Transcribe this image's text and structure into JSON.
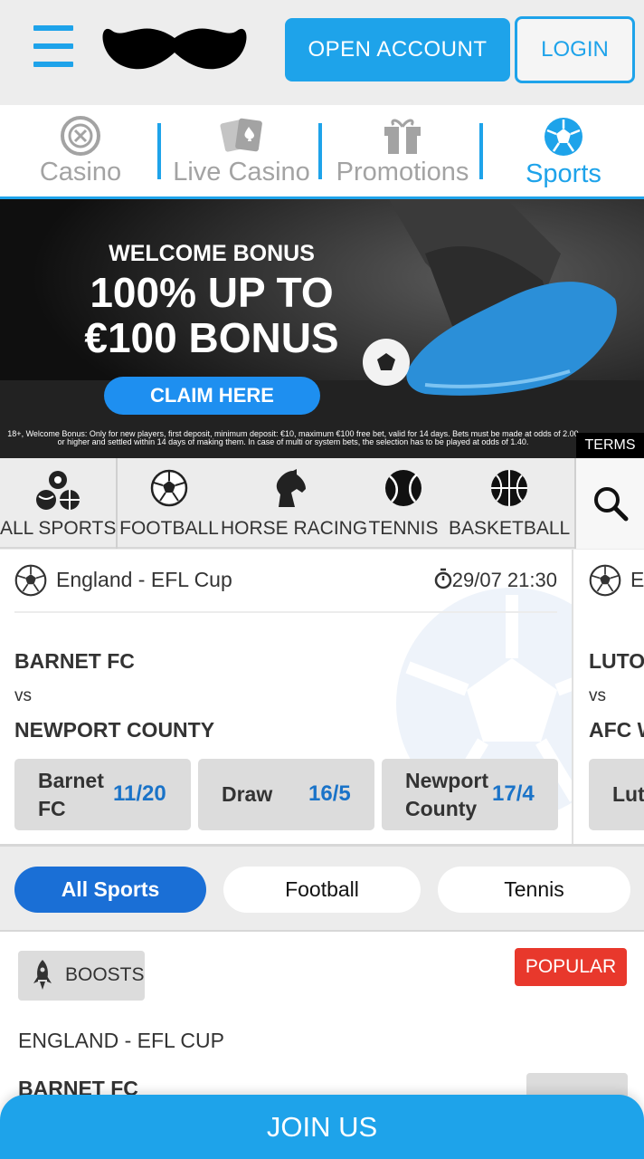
{
  "header": {
    "open_account": "OPEN ACCOUNT",
    "login": "LOGIN"
  },
  "nav": {
    "tabs": [
      {
        "label": "Casino",
        "active": false
      },
      {
        "label": "Live Casino",
        "active": false
      },
      {
        "label": "Promotions",
        "active": false
      },
      {
        "label": "Sports",
        "active": true
      }
    ]
  },
  "banner": {
    "welcome": "WELCOME BONUS",
    "line1": "100% UP TO",
    "line2": "€100 BONUS",
    "cta": "CLAIM HERE",
    "terms_text": "18+, Welcome Bonus: Only for new players, first deposit, minimum deposit: €10, maximum €100 free bet, valid for 14 days. Bets must be made at odds of 2.00 or higher and settled within 14 days of making them. In case of multi or system bets, the selection has to be played at odds of 1.40.",
    "terms_button": "TERMS"
  },
  "sports_bar": {
    "items": [
      "ALL SPORTS",
      "FOOTBALL",
      "HORSE RACING",
      "TENNIS",
      "BASKETBALL"
    ]
  },
  "match": {
    "league": "England - EFL Cup",
    "time": "29/07 21:30",
    "home": "BARNET FC",
    "vs": "vs",
    "away": "NEWPORT COUNTY",
    "odds": [
      {
        "name_l1": "Barnet",
        "name_l2": "FC",
        "price": "11/20"
      },
      {
        "name_l1": "Draw",
        "name_l2": "",
        "price": "16/5"
      },
      {
        "name_l1": "Newport",
        "name_l2": "County",
        "price": "17/4"
      }
    ]
  },
  "match2": {
    "league": "En",
    "home": "LUTON",
    "vs": "vs",
    "away": "AFC W",
    "odd_name": "Luto"
  },
  "filters": [
    "All Sports",
    "Football",
    "Tennis"
  ],
  "boosts": {
    "tag": "BOOSTS",
    "popular": "POPULAR",
    "league": "ENGLAND - EFL CUP",
    "team": "BARNET FC"
  },
  "join": "JOIN US",
  "colors": {
    "brand_blue": "#1ea3ea",
    "active_pill": "#1a6fd6",
    "odds_blue": "#1a73c8",
    "popular_red": "#e8382c"
  }
}
